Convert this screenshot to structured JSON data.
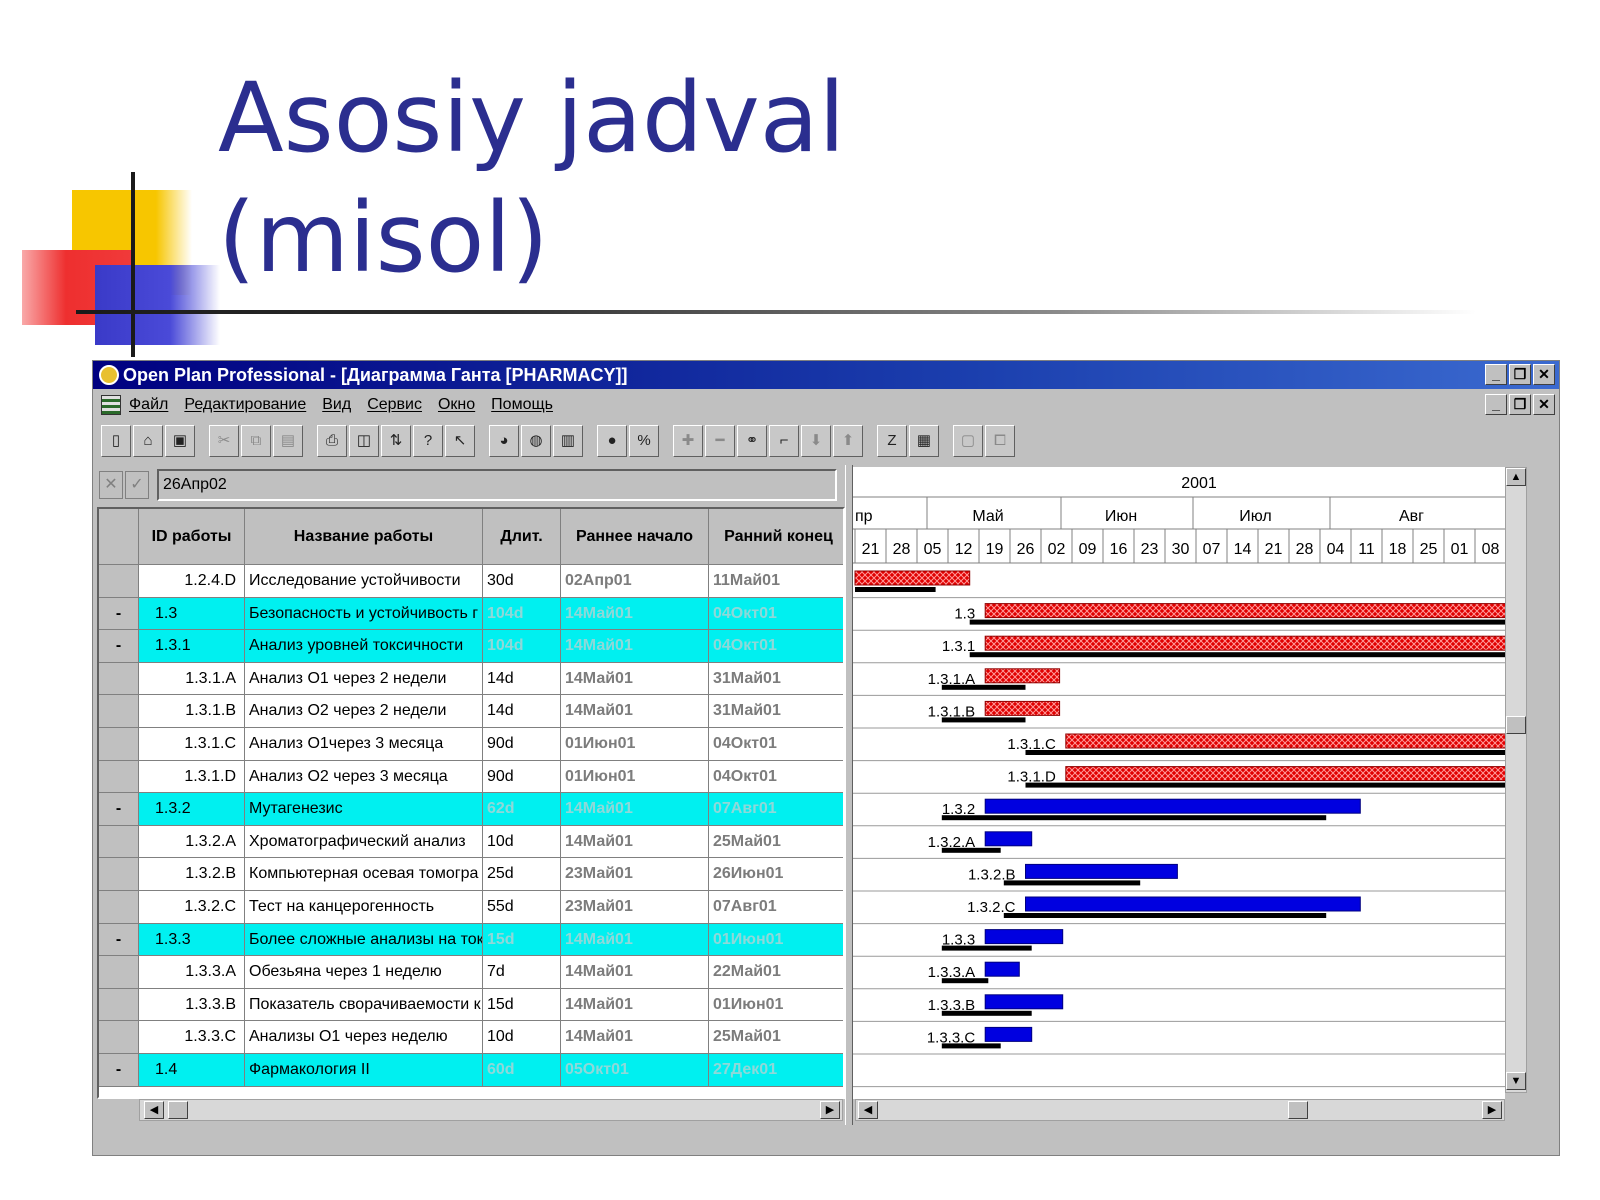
{
  "slide": {
    "title": "Asosiy jadval\n(misol)"
  },
  "window": {
    "title": "Open Plan Professional - [Диаграмма Ганта [PHARMACY]]",
    "controls": [
      "_",
      "❐",
      "✕"
    ]
  },
  "menu": {
    "items": [
      "Файл",
      "Редактирование",
      "Вид",
      "Сервис",
      "Окно",
      "Помощь"
    ]
  },
  "toolbar": {
    "icons": [
      "new-file-icon",
      "open-folder-icon",
      "save-icon",
      "cut-icon",
      "copy-icon",
      "paste-icon",
      "print-icon",
      "print-preview-icon",
      "export-icon",
      "help-icon",
      "context-help-icon",
      "pie-chart-icon",
      "globe-icon",
      "bar-chart-icon",
      "coin-icon",
      "percent-icon",
      "plus-icon",
      "minus-icon",
      "link-icon",
      "unlink-icon",
      "move-down-icon",
      "move-up-icon",
      "zoom-icon",
      "view-icon",
      "window-icon",
      "window-restore-icon"
    ]
  },
  "entry": {
    "value": "26Апр02",
    "cancel": "✕",
    "confirm": "✓"
  },
  "grid": {
    "columns": [
      "ID работы",
      "Название работы",
      "Длит.",
      "Раннее начало",
      "Ранний конец"
    ],
    "rows": [
      {
        "sel": "",
        "id": "1.2.4.D",
        "name": "Исследование устойчивости",
        "dur": "30d",
        "start": "02Апр01",
        "end": "11Май01",
        "summary": false
      },
      {
        "sel": "-",
        "id": "1.3",
        "name": "Безопасность и устойчивость г",
        "dur": "104d",
        "start": "14Май01",
        "end": "04Окт01",
        "summary": true
      },
      {
        "sel": "-",
        "id": "1.3.1",
        "name": "Анализ уровней токсичности",
        "dur": "104d",
        "start": "14Май01",
        "end": "04Окт01",
        "summary": true
      },
      {
        "sel": "",
        "id": "1.3.1.A",
        "name": "Анализ  О1 через 2 недели",
        "dur": "14d",
        "start": "14Май01",
        "end": "31Май01",
        "summary": false
      },
      {
        "sel": "",
        "id": "1.3.1.B",
        "name": "Анализ  О2 через 2 недели",
        "dur": "14d",
        "start": "14Май01",
        "end": "31Май01",
        "summary": false
      },
      {
        "sel": "",
        "id": "1.3.1.C",
        "name": "Анализ О1через 3 месяца",
        "dur": "90d",
        "start": "01Июн01",
        "end": "04Окт01",
        "summary": false
      },
      {
        "sel": "",
        "id": "1.3.1.D",
        "name": "Анализ О2 через 3 месяца",
        "dur": "90d",
        "start": "01Июн01",
        "end": "04Окт01",
        "summary": false
      },
      {
        "sel": "-",
        "id": "1.3.2",
        "name": "Мутагенезис",
        "dur": "62d",
        "start": "14Май01",
        "end": "07Авг01",
        "summary": true
      },
      {
        "sel": "",
        "id": "1.3.2.A",
        "name": "Хроматографический анализ",
        "dur": "10d",
        "start": "14Май01",
        "end": "25Май01",
        "summary": false
      },
      {
        "sel": "",
        "id": "1.3.2.B",
        "name": "Компьютерная осевая томогра",
        "dur": "25d",
        "start": "23Май01",
        "end": "26Июн01",
        "summary": false
      },
      {
        "sel": "",
        "id": "1.3.2.C",
        "name": "Тест на канцерогенность",
        "dur": "55d",
        "start": "23Май01",
        "end": "07Авг01",
        "summary": false
      },
      {
        "sel": "-",
        "id": "1.3.3",
        "name": "Более сложные анализы на ток",
        "dur": "15d",
        "start": "14Май01",
        "end": "01Июн01",
        "summary": true
      },
      {
        "sel": "",
        "id": "1.3.3.A",
        "name": "Обезьяна через 1 неделю",
        "dur": "7d",
        "start": "14Май01",
        "end": "22Май01",
        "summary": false
      },
      {
        "sel": "",
        "id": "1.3.3.B",
        "name": "Показатель сворачиваемости к",
        "dur": "15d",
        "start": "14Май01",
        "end": "01Июн01",
        "summary": false
      },
      {
        "sel": "",
        "id": "1.3.3.C",
        "name": "Анализы О1 через неделю",
        "dur": "10d",
        "start": "14Май01",
        "end": "25Май01",
        "summary": false
      },
      {
        "sel": "-",
        "id": "1.4",
        "name": "Фармакология  II",
        "dur": "60d",
        "start": "05Окт01",
        "end": "27Дек01",
        "summary": true
      }
    ]
  },
  "gantt": {
    "year": "2001",
    "months": [
      "пр",
      "Май",
      "Июн",
      "Июл",
      "Авг"
    ],
    "weeks": [
      "21",
      "28",
      "05",
      "12",
      "19",
      "26",
      "02",
      "09",
      "16",
      "23",
      "30",
      "07",
      "14",
      "21",
      "28",
      "04",
      "11",
      "18",
      "25",
      "01",
      "08"
    ],
    "colors": {
      "critical": "#e00000",
      "normal": "#0000e0",
      "baseline": "#000000",
      "summaryRow": "#00f0f0"
    },
    "bars": [
      {
        "label": "",
        "start": 0,
        "end": 3.7,
        "color": "critical",
        "baseline": [
          0,
          2.6
        ]
      },
      {
        "label": "1.3",
        "start": 4.2,
        "end": 21,
        "color": "critical",
        "baseline": [
          3.7,
          21
        ]
      },
      {
        "label": "1.3.1",
        "start": 4.2,
        "end": 21,
        "color": "critical",
        "baseline": [
          3.7,
          21
        ]
      },
      {
        "label": "1.3.1.A",
        "start": 4.2,
        "end": 6.6,
        "color": "critical",
        "baseline": [
          2.8,
          5.5
        ]
      },
      {
        "label": "1.3.1.B",
        "start": 4.2,
        "end": 6.6,
        "color": "critical",
        "baseline": [
          2.8,
          5.5
        ]
      },
      {
        "label": "1.3.1.C",
        "start": 6.8,
        "end": 21,
        "color": "critical",
        "baseline": [
          5.5,
          21
        ]
      },
      {
        "label": "1.3.1.D",
        "start": 6.8,
        "end": 21,
        "color": "critical",
        "baseline": [
          5.5,
          21
        ]
      },
      {
        "label": "1.3.2",
        "start": 4.2,
        "end": 16.3,
        "color": "normal",
        "baseline": [
          2.8,
          15.2
        ]
      },
      {
        "label": "1.3.2.A",
        "start": 4.2,
        "end": 5.7,
        "color": "normal",
        "baseline": [
          2.8,
          4.7
        ]
      },
      {
        "label": "1.3.2.B",
        "start": 5.5,
        "end": 10.4,
        "color": "normal",
        "baseline": [
          4.8,
          9.2
        ]
      },
      {
        "label": "1.3.2.C",
        "start": 5.5,
        "end": 16.3,
        "color": "normal",
        "baseline": [
          4.8,
          15.2
        ]
      },
      {
        "label": "1.3.3",
        "start": 4.2,
        "end": 6.7,
        "color": "normal",
        "baseline": [
          2.8,
          5.7
        ]
      },
      {
        "label": "1.3.3.A",
        "start": 4.2,
        "end": 5.3,
        "color": "normal",
        "baseline": [
          2.8,
          4.3
        ]
      },
      {
        "label": "1.3.3.B",
        "start": 4.2,
        "end": 6.7,
        "color": "normal",
        "baseline": [
          2.8,
          5.7
        ]
      },
      {
        "label": "1.3.3.C",
        "start": 4.2,
        "end": 5.7,
        "color": "normal",
        "baseline": [
          2.8,
          4.7
        ]
      },
      {
        "label": "",
        "start": 0,
        "end": 0,
        "color": "normal",
        "baseline": [
          0,
          0
        ]
      }
    ]
  }
}
